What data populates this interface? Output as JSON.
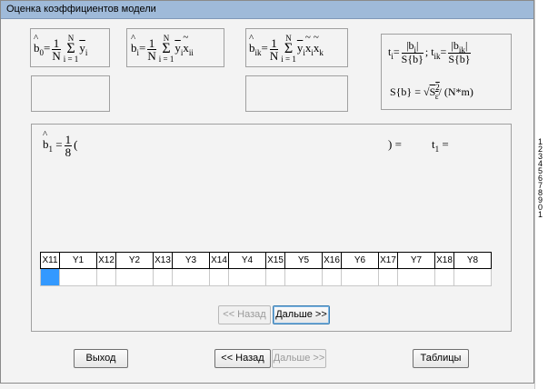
{
  "window": {
    "title": "Оценка коэффициентов модели"
  },
  "formulas": {
    "b0": {
      "lhs": "b",
      "lhs_sub": "0",
      "eq": "=",
      "frac_num": "1",
      "frac_den": "N",
      "sum_top": "N",
      "sum_bottom": "i = 1",
      "term": "y",
      "term_sub": "i"
    },
    "bi": {
      "lhs": "b",
      "lhs_sub": "i",
      "eq": "=",
      "frac_num": "1",
      "frac_den": "N",
      "sum_top": "N",
      "sum_bottom": "i = 1",
      "term": "y",
      "term_sub": "i",
      "x": "x",
      "x_sub": "ii"
    },
    "bik": {
      "lhs": "b",
      "lhs_sub": "ik",
      "eq": "=",
      "frac_num": "1",
      "frac_den": "N",
      "sum_top": "N",
      "sum_bottom": "i = 1",
      "term": "y",
      "term_sub": "i",
      "x1": "x",
      "x1_sub": "i",
      "x2": "x",
      "x2_sub": "k"
    },
    "t": {
      "ti": "t",
      "ti_sub": "i",
      "ti_num": "|b",
      "ti_num_sub": "i",
      "ti_num_end": "|",
      "ti_den": "S{b}",
      "sep": ";",
      "tik": "t",
      "tik_sub": "ik",
      "tik_num": "|b",
      "tik_num_sub": "ik",
      "tik_num_end": "|",
      "tik_den": "S{b}"
    },
    "sb": {
      "lhs": "S{b} =",
      "root": "√",
      "s": "S",
      "s_sup": "2",
      "s_sub": "ε",
      "rest": "/ (N*m)"
    }
  },
  "main": {
    "b_label": "b",
    "b_sub": "1",
    "eq": "=",
    "frac_num": "1",
    "frac_den": "8",
    "open_paren": "(",
    "close_paren": ") =",
    "t_label": "t",
    "t_sub": "1",
    "t_eq": "="
  },
  "table": {
    "headers": [
      "X11",
      "Y1",
      "X12",
      "Y2",
      "X13",
      "Y3",
      "X14",
      "Y4",
      "X15",
      "Y5",
      "X16",
      "Y6",
      "X17",
      "Y7",
      "X18",
      "Y8"
    ],
    "values": [
      "",
      "",
      "",
      "",
      "",
      "",
      "",
      "",
      "",
      "",
      "",
      "",
      "",
      "",
      "",
      ""
    ]
  },
  "inner_nav": {
    "back": "<< Назад",
    "next": "Дальше >>"
  },
  "bottom": {
    "exit": "Выход",
    "back": "<< Назад",
    "next": "Дальше >>",
    "tables": "Таблицы"
  },
  "right_strip": {
    "ticks": [
      "1",
      "2",
      "3",
      "4",
      "5",
      "6",
      "7",
      "8",
      "9",
      "0",
      "1"
    ]
  },
  "colors": {
    "titlebar": "#9fbad9",
    "selection": "#3399ff",
    "window": "#f3f3f3"
  }
}
